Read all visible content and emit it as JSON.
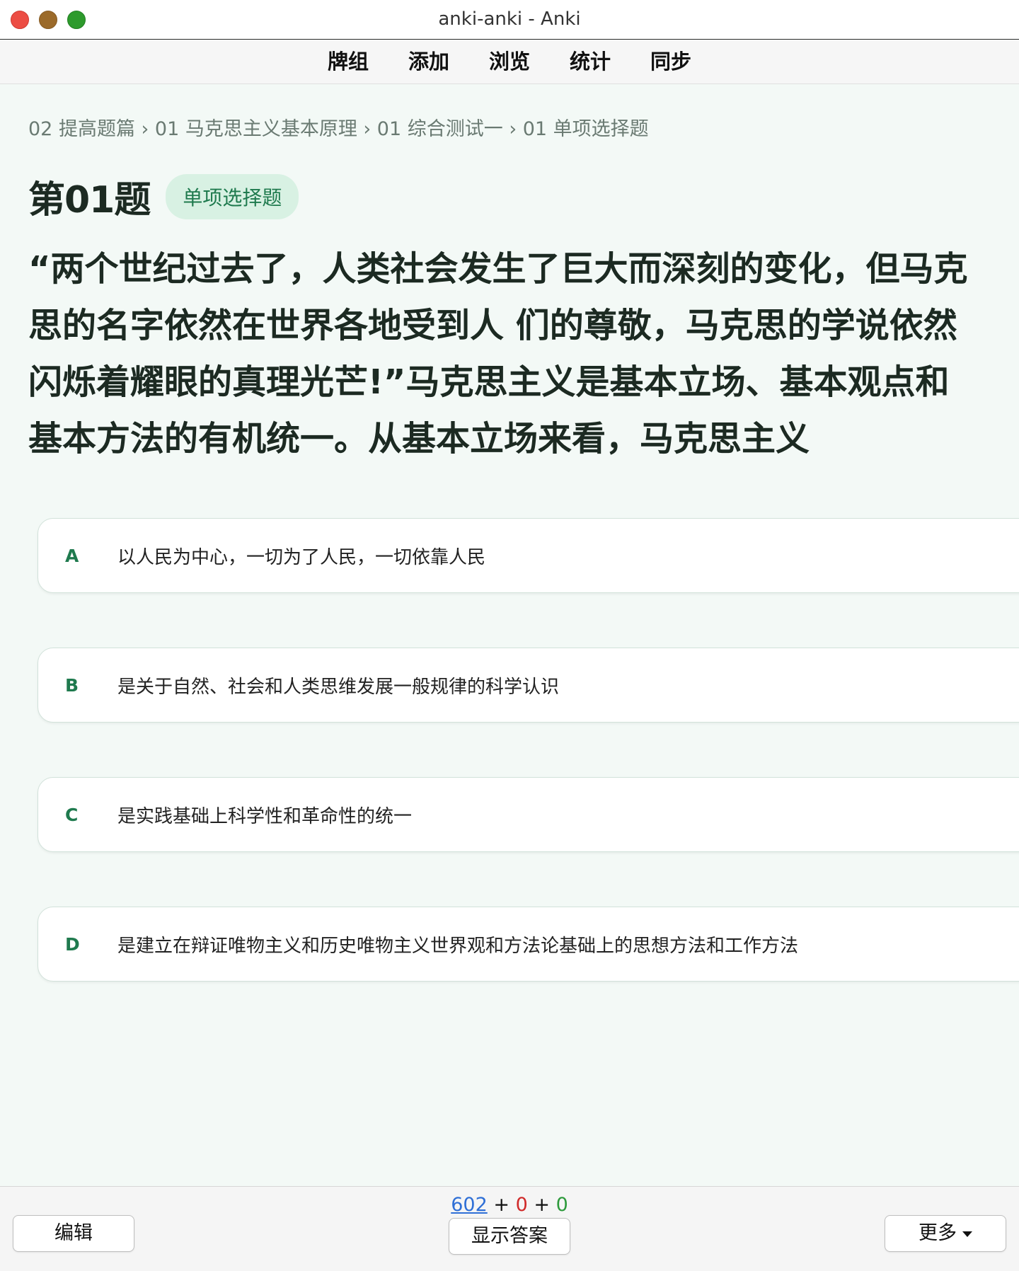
{
  "window": {
    "title": "anki-anki - Anki"
  },
  "toolbar": {
    "items": [
      "牌组",
      "添加",
      "浏览",
      "统计",
      "同步"
    ]
  },
  "breadcrumb": "02 提高题篇 › 01 马克思主义基本原理 › 01 综合测试一 › 01 单项选择题",
  "question": {
    "number": "第01题",
    "type_badge": "单项选择题",
    "text": "“两个世纪过去了，人类社会发生了巨大而深刻的变化，但马克思的名字依然在世界各地受到人 们的尊敬，马克思的学说依然闪烁着耀眼的真理光芒!”马克思主义是基本立场、基本观点和 基本方法的有机统一。从基本立场来看，马克思主义"
  },
  "options": [
    {
      "letter": "A",
      "text": "以人民为中心，一切为了人民，一切依靠人民"
    },
    {
      "letter": "B",
      "text": "是关于自然、社会和人类思维发展一般规律的科学认识"
    },
    {
      "letter": "C",
      "text": "是实践基础上科学性和革命性的统一"
    },
    {
      "letter": "D",
      "text": "是建立在辩证唯物主义和历史唯物主义世界观和方法论基础上的思想方法和工作方法"
    }
  ],
  "bottom": {
    "count_new": "602",
    "count_learn": "0",
    "count_review": "0",
    "plus": "+",
    "edit_label": "编辑",
    "show_answer_label": "显示答案",
    "more_label": "更多"
  },
  "colors": {
    "accent_green": "#1f7a4e",
    "badge_bg": "#d8f1e3",
    "new_blue": "#2f6fd6",
    "learn_red": "#d02a2a",
    "review_green": "#2e9a3c"
  }
}
